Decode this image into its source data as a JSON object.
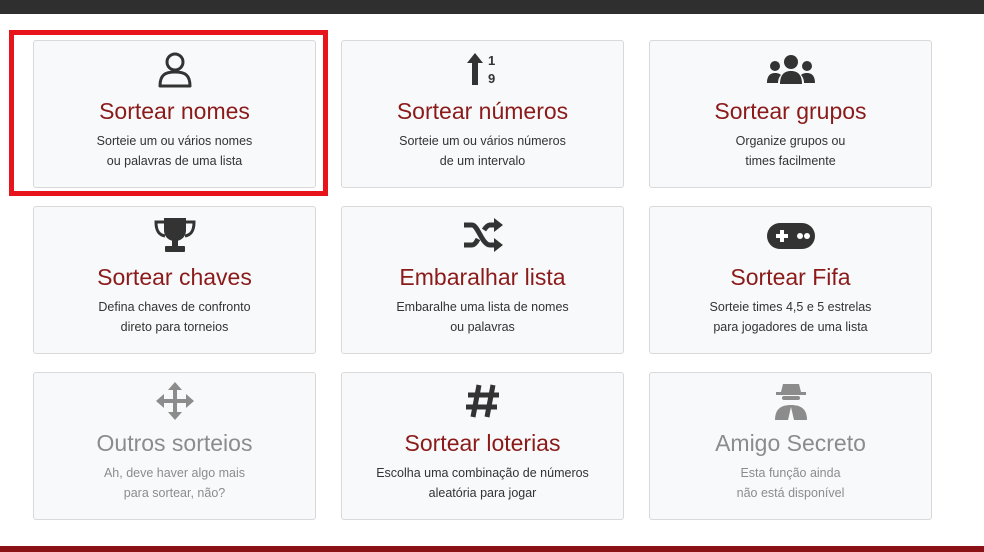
{
  "cards": [
    {
      "title": "Sortear nomes",
      "desc1": "Sorteie um ou vários nomes",
      "desc2": "ou palavras de uma lista",
      "icon": "user-icon"
    },
    {
      "title": "Sortear números",
      "desc1": "Sorteie um ou vários números",
      "desc2": "de um intervalo",
      "icon": "sort-numeric-icon"
    },
    {
      "title": "Sortear grupos",
      "desc1": "Organize grupos ou",
      "desc2": "times facilmente",
      "icon": "users-icon"
    },
    {
      "title": "Sortear chaves",
      "desc1": "Defina chaves de confronto",
      "desc2": "direto para torneios",
      "icon": "trophy-icon"
    },
    {
      "title": "Embaralhar lista",
      "desc1": "Embaralhe uma lista de nomes",
      "desc2": "ou palavras",
      "icon": "shuffle-icon"
    },
    {
      "title": "Sortear Fifa",
      "desc1": "Sorteie times 4,5 e 5 estrelas",
      "desc2": "para jogadores de uma lista",
      "icon": "gamepad-icon"
    },
    {
      "title": "Outros sorteios",
      "desc1": "Ah, deve haver algo mais",
      "desc2": "para sortear, não?",
      "icon": "arrows-move-icon",
      "disabled": true
    },
    {
      "title": "Sortear loterias",
      "desc1": "Escolha uma combinação de números",
      "desc2": "aleatória para jogar",
      "icon": "hashtag-icon"
    },
    {
      "title": "Amigo Secreto",
      "desc1": "Esta função ainda",
      "desc2": "não está disponível",
      "icon": "spy-icon",
      "disabled": true
    }
  ],
  "colors": {
    "title": "#8b1a1a",
    "disabled": "#8c8c8c",
    "highlight": "#e8141b",
    "topbar": "#2f2f2f",
    "bottombar": "#8a1116"
  }
}
